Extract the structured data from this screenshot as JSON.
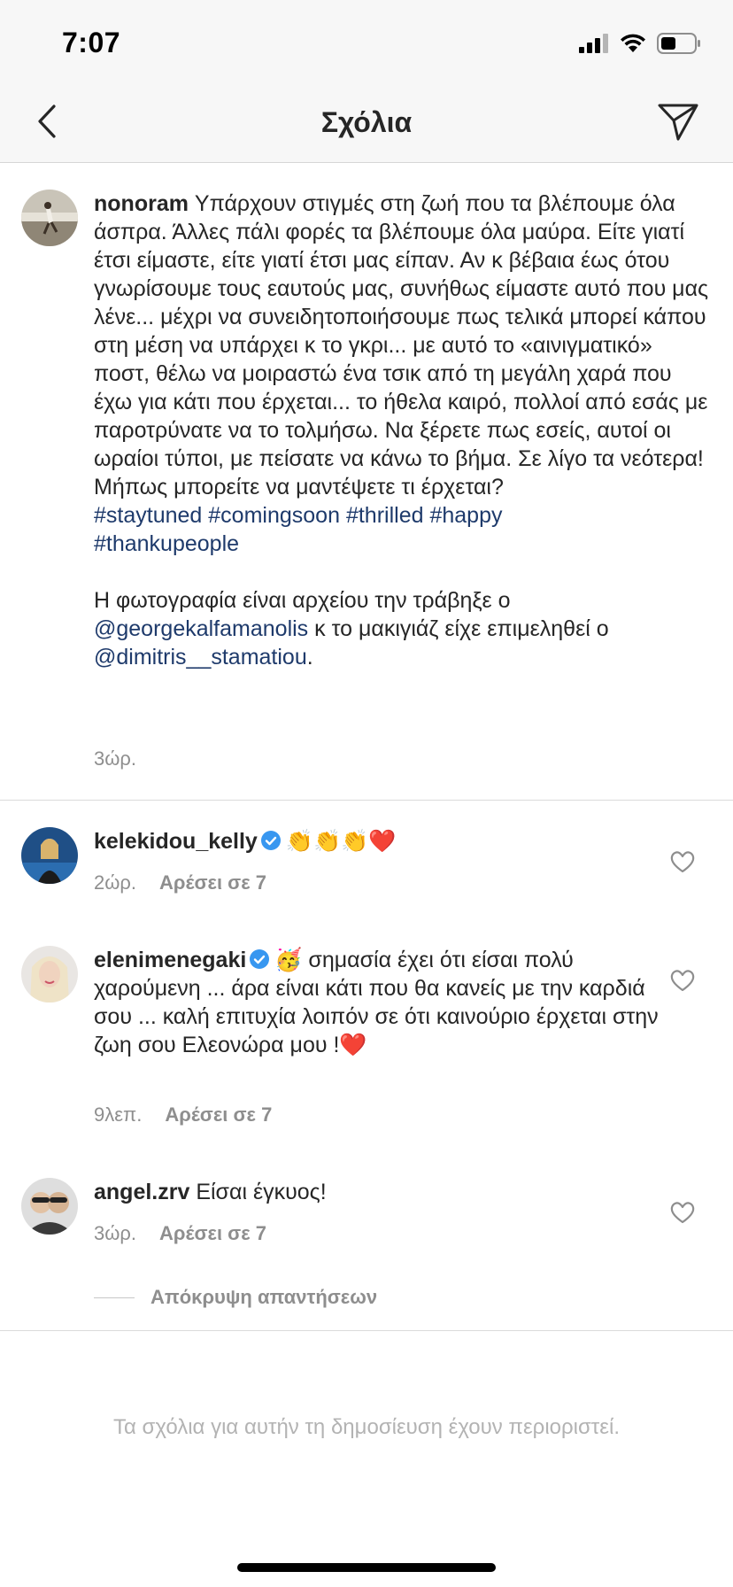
{
  "status_bar": {
    "time": "7:07"
  },
  "header": {
    "title": "Σχόλια"
  },
  "icons": {
    "back": "chevron-left-icon",
    "share": "paper-plane-icon",
    "heart": "heart-outline-icon",
    "verified": "verified-badge-icon"
  },
  "colors": {
    "hashtag": "#1e3a6b",
    "meta": "#8e8e8e",
    "verified": "#3897f0",
    "red_heart": "#e0202e"
  },
  "caption": {
    "username": "nonoram",
    "body": "Υπάρχουν στιγμές στη ζωή που τα βλέπουμε όλα άσπρα. Άλλες πάλι φορές τα βλέπουμε όλα μαύρα. Είτε γιατί έτσι είμαστε, είτε γιατί έτσι μας είπαν. Αν κ βέβαια έως ότου γνωρίσουμε τους εαυτούς μας, συνήθως είμαστε αυτό που μας λένε... μέχρι να συνειδητοποιήσουμε πως τελικά μπορεί κάπου στη μέση να υπάρχει κ το γκρι... με αυτό το «αινιγματικό» ποστ, θέλω να μοιραστώ ένα τσικ από τη μεγάλη χαρά που έχω για κάτι που έρχεται... το ήθελα καιρό, πολλοί από εσάς με παροτρύνατε να το τολμήσω. Να ξέρετε πως εσείς, αυτοί οι ωραίοι τύποι, με πείσατε να κάνω το βήμα. Σε λίγο τα νεότερα! Μήπως μπορείτε να μαντέψετε τι έρχεται?",
    "hashtags": [
      "#staytuned",
      "#comingsoon",
      "#thrilled",
      "#happy",
      "#thankupeople"
    ],
    "photo_line_start": "Η φωτογραφία είναι αρχείου την τράβηξε ο",
    "mention_1": "@georgekalfamanolis",
    "photo_line_middle": "κ το μακιγιάζ είχε επιμεληθεί ο",
    "mention_2": "@dimitris__stamatiou",
    "photo_line_end": ".",
    "time": "3ώρ."
  },
  "comments": [
    {
      "username": "kelekidou_kelly",
      "verified": true,
      "text": "👏👏👏❤️",
      "time": "2ώρ.",
      "likes": "Αρέσει σε 7"
    },
    {
      "username": "elenimenegaki",
      "verified": true,
      "emoji": "🥳",
      "text": "σημασία έχει ότι είσαι πολύ χαρούμενη ... άρα είναι κάτι που θα κανείς με την καρδιά σου ... καλή επιτυχία λοιπόν σε ότι καινούριο έρχεται στην ζωη σου Ελεονώρα μου !",
      "text_end_emoji": "❤️",
      "time": "9λεπ.",
      "likes": "Αρέσει σε 7"
    },
    {
      "username": "angel.zrv",
      "verified": false,
      "text": "Είσαι έγκυος!",
      "time": "3ώρ.",
      "likes": "Αρέσει σε 7"
    }
  ],
  "hide_replies": "Απόκρυψη απαντήσεων",
  "restricted_notice": "Τα σχόλια για αυτήν τη δημοσίευση έχουν περιοριστεί."
}
